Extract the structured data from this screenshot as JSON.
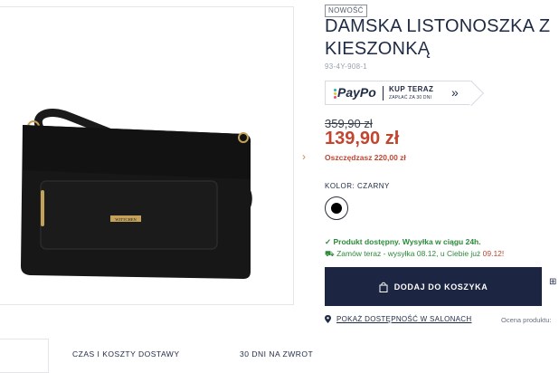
{
  "product": {
    "badge": "NOWOŚĆ",
    "title": "DAMSKA LISTONOSZKA Z\nKIESZONKĄ",
    "sku": "93-4Y-908-1",
    "brand_plate": "WITTCHEN"
  },
  "paypo": {
    "logo": "PayPo",
    "main": "KUP TERAZ",
    "sub": "ZAPŁAĆ ZA 30 DNI",
    "chevron": "»"
  },
  "pricing": {
    "old_price": "359,90 zł",
    "new_price": "139,90 zł",
    "savings": "Oszczędzasz 220,00 zł"
  },
  "color": {
    "label": "KOLOR: CZARNY",
    "swatch_hex": "#000000"
  },
  "availability": {
    "status": "✓ Produkt dostępny. Wysyłka w ciągu 24h.",
    "order_prefix": "Zamów teraz - wysyłka 08.12, u Ciebie już ",
    "order_date": "09.12!"
  },
  "actions": {
    "add_to_cart": "DODAJ DO KOSZYKA",
    "store_link": "POKAŻ DOSTĘPNOŚĆ W SALONACH",
    "rating_label": "Ocena produktu:"
  },
  "tabs": [
    {
      "label": ""
    },
    {
      "label": "CZAS I KOSZTY DOSTAWY"
    },
    {
      "label": "30 DNI NA ZWROT"
    }
  ],
  "icons": {
    "gallery_next": "›",
    "truck": "⛟",
    "pin": "⚲",
    "bag": "bag-icon",
    "cart_side": "⊞"
  },
  "colors": {
    "navy": "#1c2541",
    "sale_red": "#c2452f",
    "stock_green": "#2c8a3a"
  }
}
